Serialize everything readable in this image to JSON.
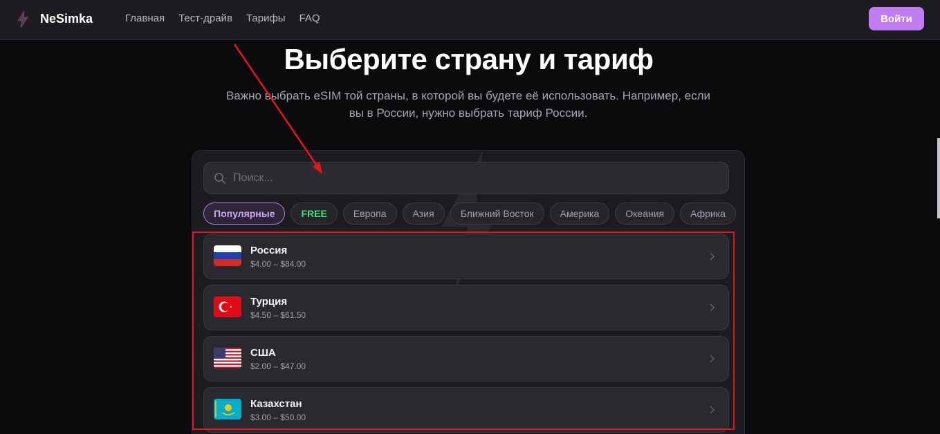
{
  "header": {
    "brand": "NeSimka",
    "nav": [
      "Главная",
      "Тест-драйв",
      "Тарифы",
      "FAQ"
    ],
    "login_label": "Войти",
    "accent_color": "#c07cf0"
  },
  "hero": {
    "title": "Выберите страну и тариф",
    "subtitle": "Важно выбрать eSIM той страны, в которой вы будете её использовать. Например, если вы в России, нужно выбрать тариф России."
  },
  "search": {
    "placeholder": "Поиск...",
    "value": ""
  },
  "categories": [
    {
      "label": "Популярные",
      "active": true
    },
    {
      "label": "FREE",
      "active": false
    },
    {
      "label": "Европа",
      "active": false
    },
    {
      "label": "Азия",
      "active": false
    },
    {
      "label": "Ближний Восток",
      "active": false
    },
    {
      "label": "Америка",
      "active": false
    },
    {
      "label": "Океания",
      "active": false
    },
    {
      "label": "Африка",
      "active": false
    }
  ],
  "countries": [
    {
      "name": "Россия",
      "price": "$4.00 – $84.00",
      "flag": "russia-flag-icon"
    },
    {
      "name": "Турция",
      "price": "$4.50 – $61.50",
      "flag": "turkey-flag-icon"
    },
    {
      "name": "США",
      "price": "$2.00 – $47.00",
      "flag": "usa-flag-icon"
    },
    {
      "name": "Казахстан",
      "price": "$3.00 – $50.00",
      "flag": "kazakhstan-flag-icon"
    }
  ]
}
